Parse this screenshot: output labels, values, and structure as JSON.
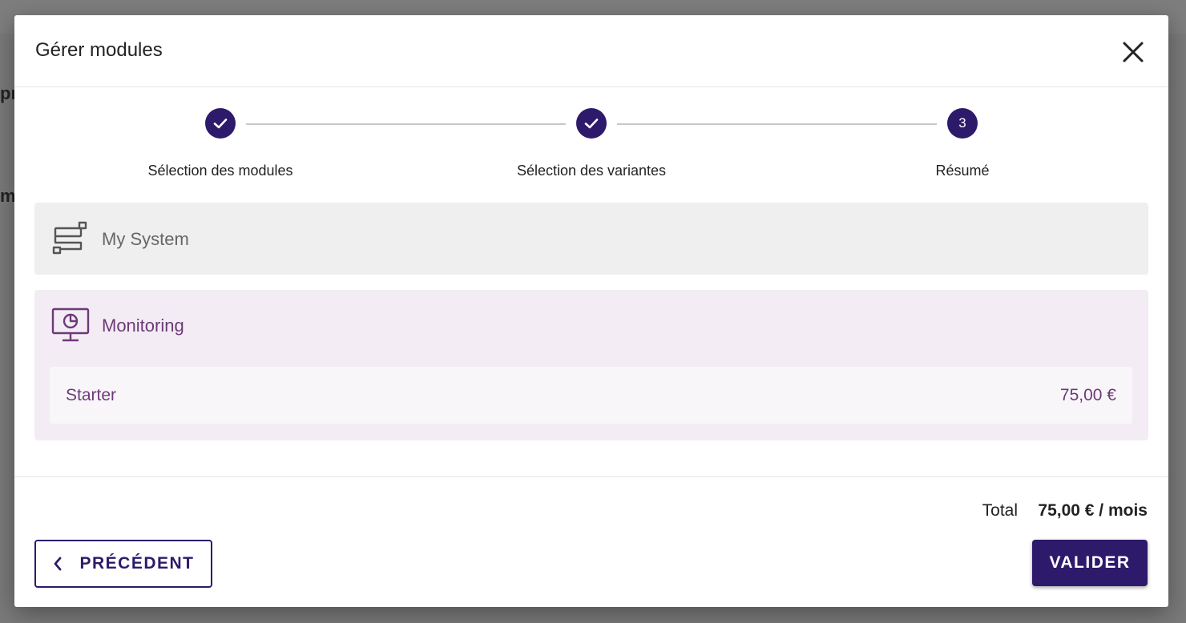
{
  "background": {
    "partial_text_1": "prc",
    "partial_text_2": "mb"
  },
  "modal": {
    "title": "Gérer modules",
    "close_icon": "close-icon"
  },
  "stepper": {
    "steps": [
      {
        "label": "Sélection des modules",
        "state": "completed",
        "icon": "check-icon"
      },
      {
        "label": "Sélection des variantes",
        "state": "completed",
        "icon": "check-icon"
      },
      {
        "label": "Résumé",
        "state": "current",
        "number": "3"
      }
    ]
  },
  "system": {
    "name": "My System",
    "icon": "system-diagram-icon"
  },
  "module": {
    "name": "Monitoring",
    "icon": "monitor-chart-icon",
    "variant": {
      "name": "Starter",
      "price": "75,00 €"
    }
  },
  "footer": {
    "total_label": "Total",
    "total_value": "75,00 € / mois",
    "prev_label": "PRÉCÉDENT",
    "validate_label": "VALIDER"
  },
  "colors": {
    "primary": "#2e1a6b",
    "module_accent": "#6d3a78",
    "module_bg": "#f3ecf5",
    "system_bg": "#efefef"
  }
}
